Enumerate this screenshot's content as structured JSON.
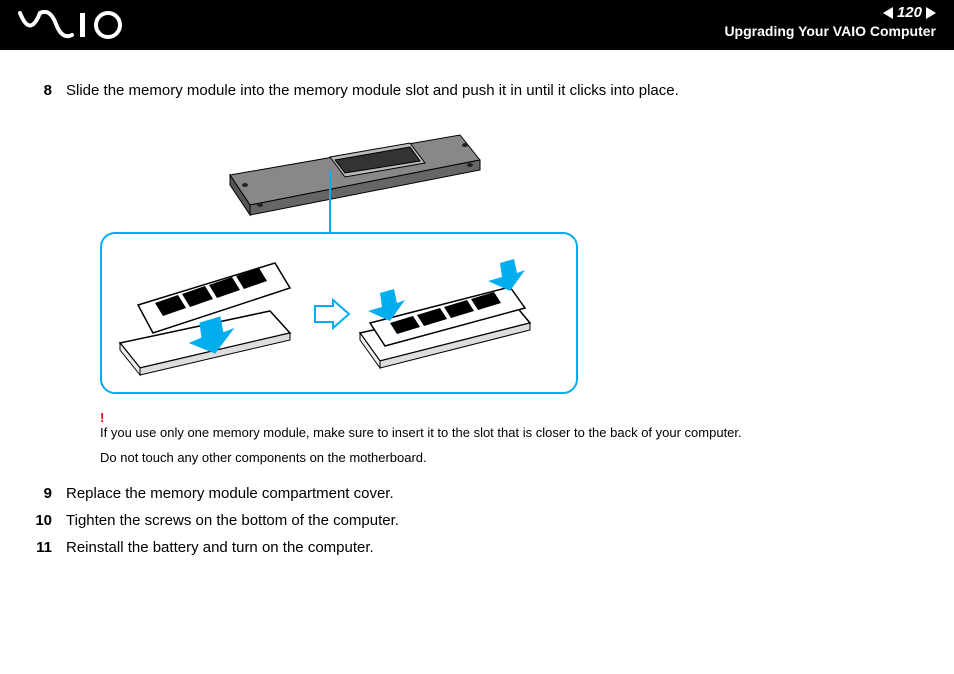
{
  "header": {
    "page_number": "120",
    "section_title": "Upgrading Your VAIO Computer"
  },
  "steps": {
    "s8": {
      "num": "8",
      "text": "Slide the memory module into the memory module slot and push it in until it clicks into place."
    },
    "s9": {
      "num": "9",
      "text": "Replace the memory module compartment cover."
    },
    "s10": {
      "num": "10",
      "text": "Tighten the screws on the bottom of the computer."
    },
    "s11": {
      "num": "11",
      "text": "Reinstall the battery and turn on the computer."
    }
  },
  "notes": {
    "bang": "!",
    "warn1": "If you use only one memory module, make sure to insert it to the slot that is closer to the back of your computer.",
    "warn2": "Do not touch any other components on the motherboard."
  },
  "icons": {
    "logo_alt": "VAIO"
  }
}
